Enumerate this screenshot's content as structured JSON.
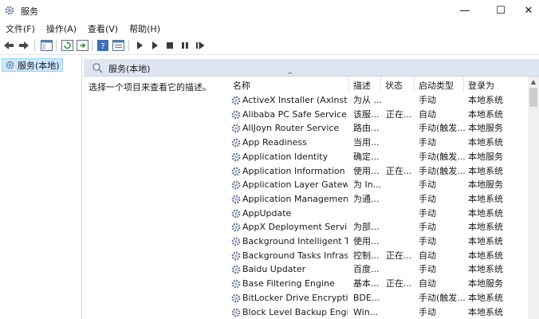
{
  "window": {
    "title": "服务",
    "minimize": "—",
    "maximize": "☐",
    "close": "✕"
  },
  "menu": [
    "文件(F)",
    "操作(A)",
    "查看(V)",
    "帮助(H)"
  ],
  "toolbar": {
    "icons": [
      "back-arrow-icon",
      "forward-arrow-icon",
      "console-tree-icon",
      "refresh-icon",
      "export-icon",
      "help-icon",
      "properties-icon",
      "start-icon",
      "start-alt-icon",
      "stop-icon",
      "pause-icon",
      "restart-icon"
    ]
  },
  "tree": {
    "selected_label": "服务(本地)"
  },
  "pane": {
    "header": "服务(本地)",
    "description": "选择一个项目来查看它的描述。",
    "columns": {
      "name": "名称",
      "desc": "描述",
      "status": "状态",
      "startup": "启动类型",
      "logon": "登录为"
    },
    "sort_arrow": "^"
  },
  "services": [
    {
      "name": "ActiveX Installer (AxInstSV)",
      "desc": "为从 ...",
      "status": "",
      "startup": "手动",
      "logon": "本地系统"
    },
    {
      "name": "Alibaba PC Safe Service",
      "desc": "该服...",
      "status": "正在...",
      "startup": "自动",
      "logon": "本地系统"
    },
    {
      "name": "AllJoyn Router Service",
      "desc": "路由...",
      "status": "",
      "startup": "手动(触发...",
      "logon": "本地服务"
    },
    {
      "name": "App Readiness",
      "desc": "当用...",
      "status": "",
      "startup": "手动",
      "logon": "本地系统"
    },
    {
      "name": "Application Identity",
      "desc": "确定...",
      "status": "",
      "startup": "手动(触发...",
      "logon": "本地服务"
    },
    {
      "name": "Application Information",
      "desc": "使用...",
      "status": "正在...",
      "startup": "手动(触发...",
      "logon": "本地系统"
    },
    {
      "name": "Application Layer Gatewa...",
      "desc": "为 In...",
      "status": "",
      "startup": "手动",
      "logon": "本地服务"
    },
    {
      "name": "Application Management",
      "desc": "为通...",
      "status": "",
      "startup": "手动",
      "logon": "本地系统"
    },
    {
      "name": "AppUpdate",
      "desc": "",
      "status": "",
      "startup": "手动",
      "logon": "本地系统"
    },
    {
      "name": "AppX Deployment Servic...",
      "desc": "为部...",
      "status": "",
      "startup": "手动",
      "logon": "本地系统"
    },
    {
      "name": "Background Intelligent T...",
      "desc": "使用...",
      "status": "",
      "startup": "手动",
      "logon": "本地系统"
    },
    {
      "name": "Background Tasks Infras...",
      "desc": "控制...",
      "status": "正在...",
      "startup": "自动",
      "logon": "本地系统"
    },
    {
      "name": "Baidu Updater",
      "desc": "百度...",
      "status": "",
      "startup": "手动",
      "logon": "本地系统"
    },
    {
      "name": "Base Filtering Engine",
      "desc": "基本...",
      "status": "正在...",
      "startup": "自动",
      "logon": "本地服务"
    },
    {
      "name": "BitLocker Drive Encryptio...",
      "desc": "BDE...",
      "status": "",
      "startup": "手动(触发...",
      "logon": "本地系统"
    },
    {
      "name": "Block Level Backup Engi...",
      "desc": "Win...",
      "status": "",
      "startup": "手动",
      "logon": "本地系统"
    }
  ]
}
